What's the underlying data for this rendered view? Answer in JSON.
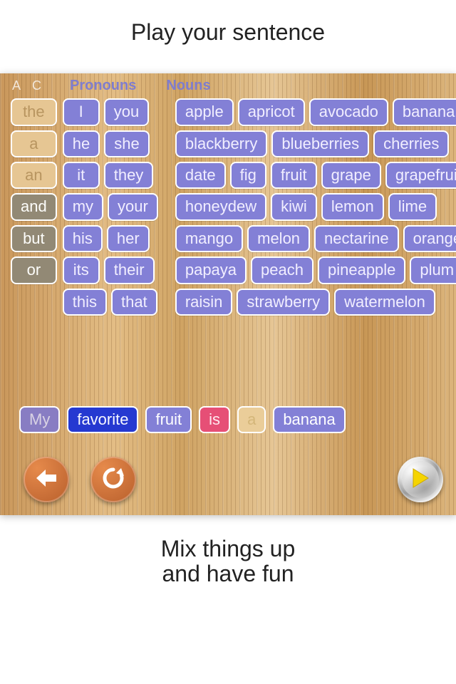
{
  "captions": {
    "top": "Play your sentence",
    "bottom_l1": "Mix things up",
    "bottom_l2": "and have fun"
  },
  "tab_headers": {
    "ac": "A  C",
    "pronouns": "Pronouns",
    "nouns": "Nouns"
  },
  "articles": {
    "tan": [
      "the",
      "a",
      "an"
    ],
    "gray": [
      "and",
      "but",
      "or"
    ]
  },
  "pronouns": [
    [
      "I",
      "you"
    ],
    [
      "he",
      "she"
    ],
    [
      "it",
      "they"
    ],
    [
      "my",
      "your"
    ],
    [
      "his",
      "her"
    ],
    [
      "its",
      "their"
    ],
    [
      "this",
      "that"
    ]
  ],
  "nouns": [
    [
      "apple",
      "apricot",
      "avocado",
      "banana"
    ],
    [
      "blackberry",
      "blueberries",
      "cherries"
    ],
    [
      "date",
      "fig",
      "fruit",
      "grape",
      "grapefruit"
    ],
    [
      "honeydew",
      "kiwi",
      "lemon",
      "lime"
    ],
    [
      "mango",
      "melon",
      "nectarine",
      "orange"
    ],
    [
      "papaya",
      "peach",
      "pineapple",
      "plum"
    ],
    [
      "raisin",
      "strawberry",
      "watermelon"
    ]
  ],
  "sentence": [
    {
      "text": "My",
      "color": "c-blend"
    },
    {
      "text": "favorite",
      "color": "c-blue"
    },
    {
      "text": "fruit",
      "color": "c-purple"
    },
    {
      "text": "is",
      "color": "c-pink"
    },
    {
      "text": "a",
      "color": "c-tan"
    },
    {
      "text": "banana",
      "color": "c-purple"
    }
  ],
  "icons": {
    "back": "arrow-left-icon",
    "refresh": "refresh-icon",
    "play": "play-icon"
  }
}
